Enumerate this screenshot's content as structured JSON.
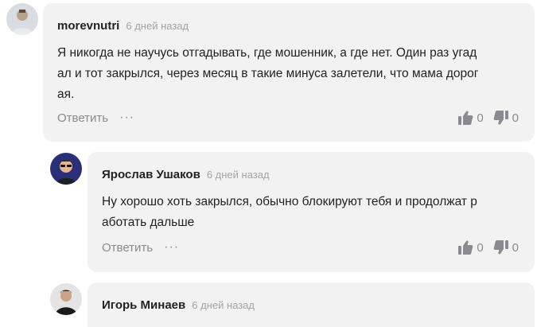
{
  "comments": [
    {
      "author": "morevnutri",
      "time": "6 дней назад",
      "lines": [
        "Я никогда не научусь отгадывать, где мошенник, а где нет. Один раз угад",
        "ал и тот закрылся, через месяц в такие минуса залетели, что мама дорог",
        "ая."
      ],
      "reply_label": "Ответить",
      "more_label": "···",
      "likes": "0",
      "dislikes": "0"
    },
    {
      "author": "Ярослав Ушаков",
      "time": "6 дней назад",
      "lines": [
        "Ну хорошо хоть закрылся, обычно блокируют тебя и продолжат р",
        "аботать дальше"
      ],
      "reply_label": "Ответить",
      "more_label": "···",
      "likes": "0",
      "dislikes": "0"
    },
    {
      "author": "Игорь Минаев",
      "time": "6 дней назад"
    }
  ],
  "icons": {
    "like": "thumbs-up-icon",
    "dislike": "thumbs-down-icon",
    "more": "more-dots-icon"
  },
  "colors": {
    "card_bg": "#f2f2f3",
    "muted": "#8a8a90",
    "time": "#a3a3a8"
  }
}
